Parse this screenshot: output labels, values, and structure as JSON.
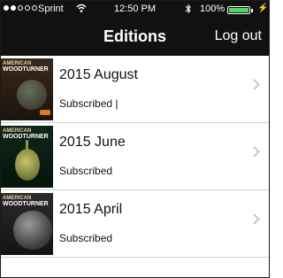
{
  "status_bar": {
    "carrier": "Sprint",
    "time": "12:50 PM",
    "battery_pct": "100%",
    "signal_bars_filled": 2,
    "battery_level": 1.0,
    "battery_color": "#4cd964"
  },
  "nav": {
    "title": "Editions",
    "logout_label": "Log out",
    "background": "#111111"
  },
  "editions": [
    {
      "title": "2015 August",
      "status": "Subscribed |",
      "cover_masthead": "AMERICAN",
      "cover_title": "WOODTURNER"
    },
    {
      "title": "2015 June",
      "status": "Subscribed",
      "cover_masthead": "AMERICAN",
      "cover_title": "WOODTURNER"
    },
    {
      "title": "2015 April",
      "status": "Subscribed",
      "cover_masthead": "AMERICAN",
      "cover_title": "WOODTURNER"
    }
  ]
}
